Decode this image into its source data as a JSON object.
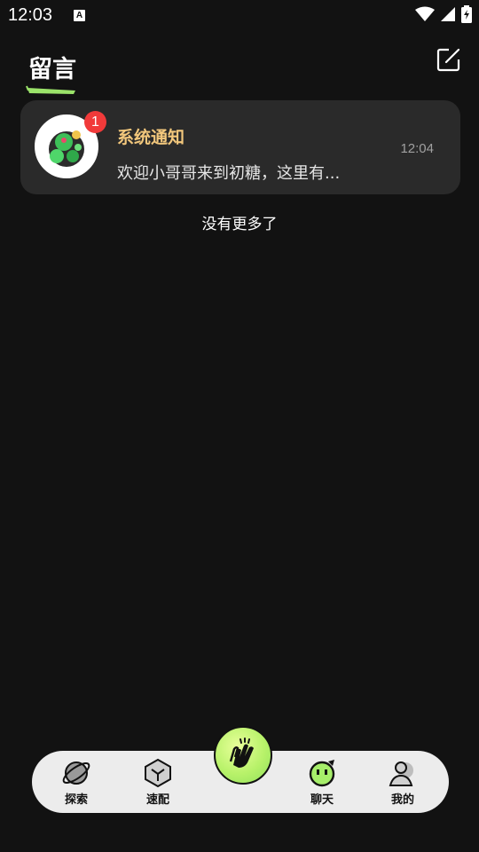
{
  "status_bar": {
    "time": "12:03",
    "notification_icon": "a-icon",
    "icons": [
      "wifi-icon",
      "signal-icon",
      "battery-icon"
    ]
  },
  "header": {
    "title": "留言",
    "compose_icon": "compose-icon"
  },
  "conversations": [
    {
      "name": "系统通知",
      "preview": "欢迎小哥哥来到初糖，这里有...",
      "time": "12:04",
      "unread": "1"
    }
  ],
  "footer_text": "没有更多了",
  "tabbar": {
    "tabs": [
      {
        "label": "探索",
        "icon": "planet-icon"
      },
      {
        "label": "速配",
        "icon": "cube-icon"
      },
      {
        "label": "",
        "icon": "clapping-hands-icon"
      },
      {
        "label": "聊天",
        "icon": "chat-face-icon"
      },
      {
        "label": "我的",
        "icon": "profile-icon"
      }
    ]
  },
  "colors": {
    "background": "#121212",
    "card": "#2a2a2a",
    "name_accent": "#f2c77c",
    "badge": "#f13a3a",
    "tabbar": "#ececec",
    "center_button": "#b8f26a"
  }
}
